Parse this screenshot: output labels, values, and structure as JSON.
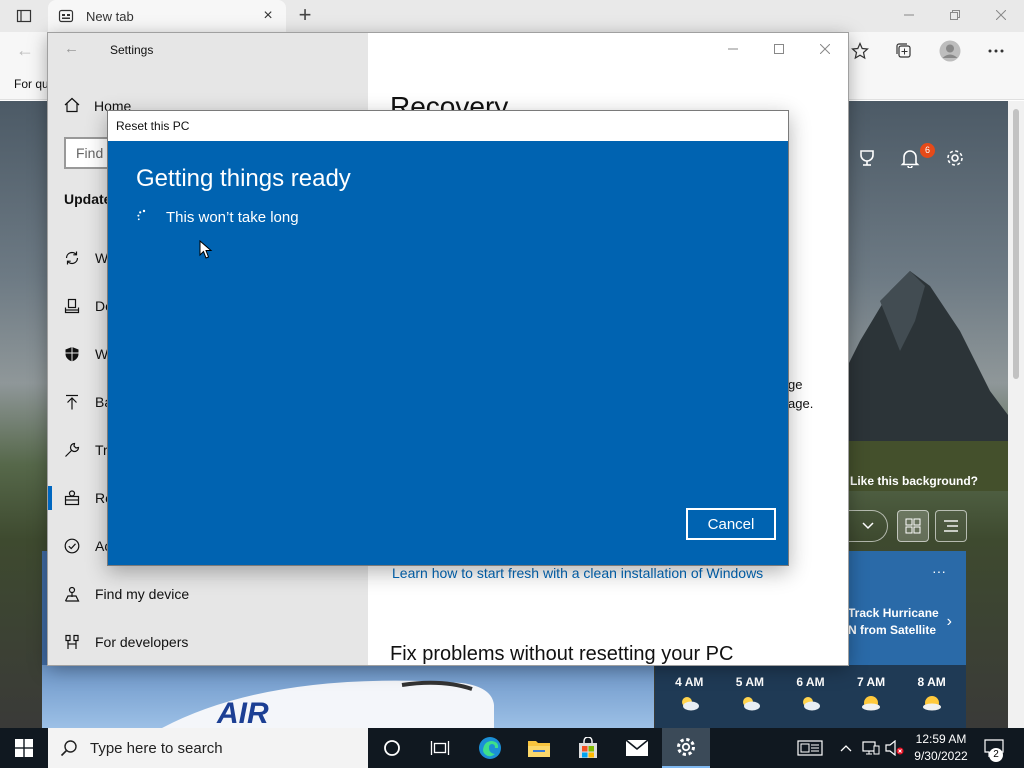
{
  "browser": {
    "tab_title": "New tab",
    "favorites_partial": "For qu",
    "notification_count": "6",
    "like_background": "Like this background?",
    "news_title_line1": "Track Hurricane",
    "news_title_line2": "N from Satellite",
    "weather": [
      {
        "hour": "4 AM",
        "icon": "partly-cloudy-icon"
      },
      {
        "hour": "5 AM",
        "icon": "partly-cloudy-icon"
      },
      {
        "hour": "6 AM",
        "icon": "partly-cloudy-icon"
      },
      {
        "hour": "7 AM",
        "icon": "partly-sunny-icon"
      },
      {
        "hour": "8 AM",
        "icon": "partly-sunny-icon"
      }
    ]
  },
  "settings": {
    "window_title": "Settings",
    "home_label": "Home",
    "search_placeholder": "Find",
    "section_title": "Update",
    "items": [
      {
        "label": "W",
        "icon": "sync-icon"
      },
      {
        "label": "De",
        "icon": "delivery-icon"
      },
      {
        "label": "W",
        "icon": "shield-icon"
      },
      {
        "label": "Ba",
        "icon": "backup-icon"
      },
      {
        "label": "Tr",
        "icon": "wrench-icon"
      },
      {
        "label": "Re",
        "icon": "recovery-icon"
      },
      {
        "label": "Ac",
        "icon": "check-circle-icon"
      },
      {
        "label": "Find my device",
        "icon": "person-pin-icon"
      },
      {
        "label": "For developers",
        "icon": "developer-icon"
      }
    ],
    "page_title": "Recovery",
    "partial_text_line1": "ge",
    "partial_text_line2": "age.",
    "link_text": "Learn how to start fresh with a clean installation of Windows",
    "section2_title": "Fix problems without resetting your PC"
  },
  "dialog": {
    "title": "Reset this PC",
    "heading": "Getting things ready",
    "subtext": "This won’t take long",
    "cancel_label": "Cancel",
    "accent": "#0063b1"
  },
  "taskbar": {
    "search_placeholder": "Type here to search",
    "time": "12:59 AM",
    "date": "9/30/2022",
    "notification_count": "2"
  }
}
